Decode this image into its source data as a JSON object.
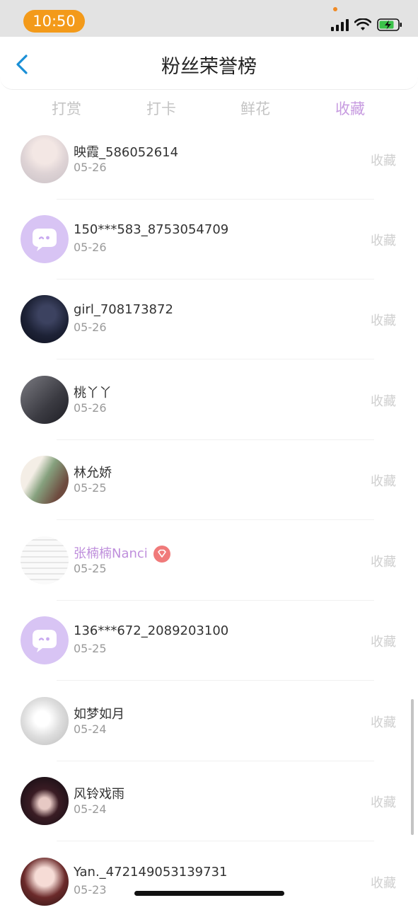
{
  "status_bar": {
    "time": "10:50"
  },
  "header": {
    "title": "粉丝荣誉榜"
  },
  "tabs": [
    {
      "label": "打赏",
      "active": false
    },
    {
      "label": "打卡",
      "active": false
    },
    {
      "label": "鲜花",
      "active": false
    },
    {
      "label": "收藏",
      "active": true
    }
  ],
  "colors": {
    "accent": "#c79be0",
    "time_pill": "#f39a1a",
    "badge": "#f07a7a"
  },
  "fans": [
    {
      "name": "映霞_586052614",
      "date": "05-26",
      "action": "收藏",
      "avatar": "photo-girl-light"
    },
    {
      "name": "150***583_8753054709",
      "date": "05-26",
      "action": "收藏",
      "avatar": "default-chat-bubble"
    },
    {
      "name": "girl_708173872",
      "date": "05-26",
      "action": "收藏",
      "avatar": "photo-dark-blue"
    },
    {
      "name": "桃丫丫",
      "date": "05-26",
      "action": "收藏",
      "avatar": "photo-dark-hair"
    },
    {
      "name": "林允娇",
      "date": "05-25",
      "action": "收藏",
      "avatar": "photo-green"
    },
    {
      "name": "张楠楠Nanci",
      "date": "05-25",
      "action": "收藏",
      "avatar": "photo-sketch",
      "vip": true
    },
    {
      "name": "136***672_2089203100",
      "date": "05-25",
      "action": "收藏",
      "avatar": "default-chat-bubble"
    },
    {
      "name": "如梦如月",
      "date": "05-24",
      "action": "收藏",
      "avatar": "photo-anime-white"
    },
    {
      "name": "风铃戏雨",
      "date": "05-24",
      "action": "收藏",
      "avatar": "photo-dark-red"
    },
    {
      "name": "Yan._472149053139731",
      "date": "05-23",
      "action": "收藏",
      "avatar": "photo-girl-red"
    }
  ]
}
